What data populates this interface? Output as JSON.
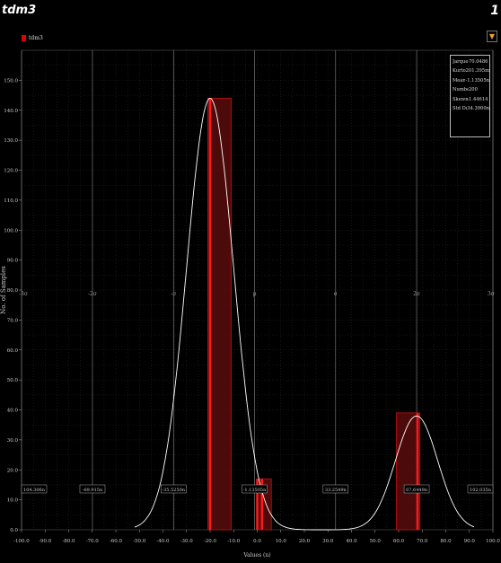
{
  "window": {
    "title": "tdm3",
    "page_number": "1"
  },
  "legend": {
    "label": "tdm3",
    "color": "#e00000"
  },
  "stats": [
    {
      "key": "Jarque-Bera",
      "value": "70.0486"
    },
    {
      "key": "Kurtosis",
      "value": "201.395m"
    },
    {
      "key": "Mean",
      "value": "-1.13505n"
    },
    {
      "key": "Number",
      "value": "200"
    },
    {
      "key": "Skewness",
      "value": "1.44614"
    },
    {
      "key": "Std Dev",
      "value": "34.3900n"
    }
  ],
  "sigma_labels": [
    "-3σ",
    "-2σ",
    "-σ",
    "μ",
    "σ",
    "2σ",
    "3σ"
  ],
  "marker_labels": [
    "104.306n",
    "-69.915n",
    "-35.5250n",
    "-1.13505n",
    "33.2549n",
    "67.6449n",
    "102.035n"
  ],
  "colors": {
    "bar_fill": "#5a0c0c",
    "bar_edge": "#c01010",
    "bar_line": "#ff1a1a",
    "curve": "#ffffff",
    "grid": "#2a2a2a"
  },
  "chart_data": {
    "type": "bar",
    "title": "",
    "xlabel": "Values (n)",
    "ylabel": "No. of Samples",
    "xlim": [
      -100.0,
      100.0
    ],
    "ylim": [
      0,
      160
    ],
    "grid": true,
    "legend_position": "top-left",
    "x_ticks": [
      "-100.0",
      "-90.0",
      "-80.0",
      "-70.0",
      "-60.0",
      "-50.0",
      "-40.0",
      "-30.0",
      "-20.0",
      "-10.0",
      "0.0",
      "10.0",
      "20.0",
      "30.0",
      "40.0",
      "50.0",
      "60.0",
      "70.0",
      "80.0",
      "90.0",
      "100.0"
    ],
    "y_ticks": [
      "0.0",
      "10.0",
      "20.0",
      "30.0",
      "40.0",
      "50.0",
      "60.0",
      "70.0",
      "80.0",
      "90.0",
      "100.0",
      "110.0",
      "120.0",
      "130.0",
      "140.0",
      "150.0"
    ],
    "bins": [
      {
        "x0": -21.0,
        "x1": -11.0,
        "count": 144
      },
      {
        "x0": 0.0,
        "x1": 6.0,
        "count": 17
      },
      {
        "x0": 59.0,
        "x1": 69.0,
        "count": 39
      }
    ],
    "values_lines": [
      -20.0,
      0.0,
      2.0,
      68.0
    ],
    "fit_curve": {
      "peaks": [
        {
          "mu": -20.0,
          "sigma": 10.0,
          "amp": 144
        },
        {
          "mu": 67.6,
          "sigma": 9.0,
          "amp": 38
        }
      ]
    },
    "sigma_positions": [
      -104.306,
      -69.915,
      -35.525,
      -1.13505,
      33.2549,
      67.6449,
      102.035
    ]
  }
}
